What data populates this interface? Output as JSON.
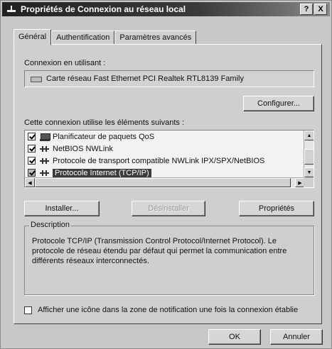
{
  "window": {
    "title": "Propriétés de Connexion au réseau local",
    "help_button": "?",
    "close_button": "X"
  },
  "tabs": [
    {
      "label": "Général",
      "active": true
    },
    {
      "label": "Authentification",
      "active": false
    },
    {
      "label": "Paramètres avancés",
      "active": false
    }
  ],
  "connection": {
    "label": "Connexion en utilisant :",
    "adapter": "Carte réseau Fast Ethernet PCI Realtek RTL8139 Family",
    "configure_button": "Configurer..."
  },
  "components": {
    "label": "Cette connexion utilise les éléments suivants :",
    "items": [
      {
        "label": "Planificateur de paquets QoS",
        "checked": true,
        "icon": "scheduler-icon"
      },
      {
        "label": "NetBIOS NWLink",
        "checked": true,
        "icon": "protocol-icon"
      },
      {
        "label": "Protocole de transport compatible NWLink IPX/SPX/NetBIOS",
        "checked": true,
        "icon": "protocol-icon"
      },
      {
        "label": "Protocole Internet (TCP/IP)",
        "checked": true,
        "icon": "protocol-icon",
        "selected": true
      }
    ]
  },
  "buttons": {
    "install": "Installer...",
    "uninstall": "Désinstaller",
    "properties": "Propriétés",
    "ok": "OK",
    "cancel": "Annuler"
  },
  "description": {
    "title": "Description",
    "text": "Protocole TCP/IP (Transmission Control Protocol/Internet Protocol). Le protocole de réseau étendu par défaut qui permet la communication entre différents réseaux interconnectés."
  },
  "notify": {
    "label": "Afficher une icône dans la zone de notification une fois la connexion établie",
    "checked": false
  }
}
